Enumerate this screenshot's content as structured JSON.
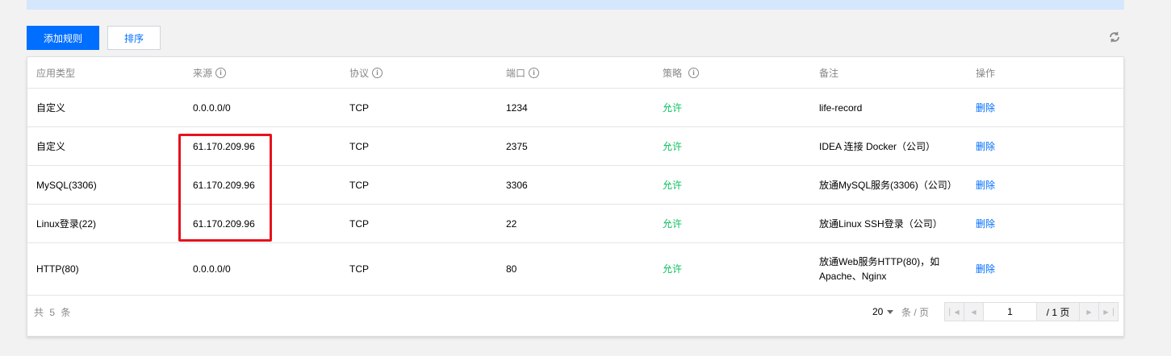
{
  "toolbar": {
    "add_rule_label": "添加规则",
    "sort_label": "排序",
    "refresh_icon": "refresh-icon"
  },
  "table": {
    "headers": {
      "app_type": "应用类型",
      "source": "来源",
      "protocol": "协议",
      "port": "端口",
      "policy": "策略",
      "note": "备注",
      "action": "操作"
    },
    "rows": [
      {
        "app_type": "自定义",
        "source": "0.0.0.0/0",
        "protocol": "TCP",
        "port": "1234",
        "policy": "允许",
        "note": "life-record",
        "action": "删除"
      },
      {
        "app_type": "自定义",
        "source": "61.170.209.96",
        "protocol": "TCP",
        "port": "2375",
        "policy": "允许",
        "note": "IDEA 连接 Docker（公司）",
        "action": "删除"
      },
      {
        "app_type": "MySQL(3306)",
        "source": "61.170.209.96",
        "protocol": "TCP",
        "port": "3306",
        "policy": "允许",
        "note": "放通MySQL服务(3306)（公司）",
        "action": "删除"
      },
      {
        "app_type": "Linux登录(22)",
        "source": "61.170.209.96",
        "protocol": "TCP",
        "port": "22",
        "policy": "允许",
        "note": "放通Linux SSH登录（公司）",
        "action": "删除"
      },
      {
        "app_type": "HTTP(80)",
        "source": "0.0.0.0/0",
        "protocol": "TCP",
        "port": "80",
        "policy": "允许",
        "note": "放通Web服务HTTP(80)，如Apache、Nginx",
        "action": "删除"
      }
    ]
  },
  "footer": {
    "total_text": "共 5 条",
    "page_size": "20",
    "per_page_text": "条 / 页",
    "current_page": "1",
    "total_pages": "/ 1 页"
  },
  "colors": {
    "primary": "#006eff",
    "allow": "#0abf5b",
    "highlight": "#e6121c"
  }
}
